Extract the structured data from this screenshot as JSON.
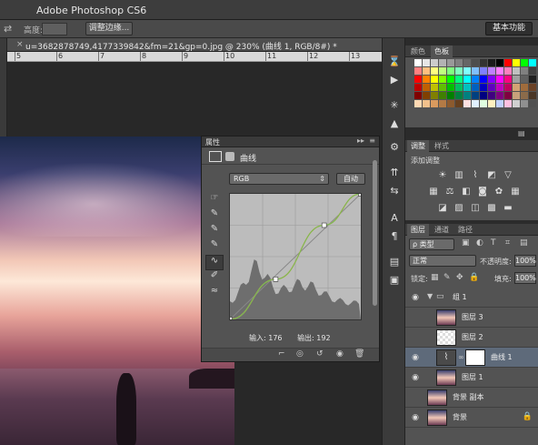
{
  "app": {
    "title": "Adobe Photoshop CS6"
  },
  "options": {
    "label": "高度:",
    "refine_edge": "调整边缘...",
    "workspace": "基本功能"
  },
  "document": {
    "tab_title": "u=3682878749,4177339842&fm=21&gp=0.jpg @ 230% (曲线 1, RGB/8#) *"
  },
  "ruler": {
    "marks": [
      "5",
      "6",
      "7",
      "8",
      "9",
      "10",
      "11",
      "12",
      "13"
    ]
  },
  "properties": {
    "title": "属性",
    "adjustment_name": "曲线",
    "preset": "RGB",
    "auto_label": "自动",
    "input_label": "输入: 176",
    "output_label": "输出: 192",
    "curve_points": [
      [
        0,
        0
      ],
      [
        0.35,
        0.32
      ],
      [
        0.72,
        0.75
      ],
      [
        1,
        1
      ]
    ]
  },
  "swatches": {
    "tabs": [
      "颜色",
      "色板"
    ],
    "active_tab": "色板",
    "colors": [
      "#ffffff",
      "#e6e6e6",
      "#cccccc",
      "#b3b3b3",
      "#999999",
      "#808080",
      "#666666",
      "#4d4d4d",
      "#333333",
      "#1a1a1a",
      "#000000",
      "#ff0000",
      "#ffff00",
      "#00ff00",
      "#00ffff",
      "#ff8080",
      "#ffbf80",
      "#ffff80",
      "#bfff80",
      "#80ff80",
      "#80ffbf",
      "#80ffff",
      "#80bfff",
      "#8080ff",
      "#bf80ff",
      "#ff80ff",
      "#ff80bf",
      "#c0c0c0",
      "#808080",
      "#404040",
      "#ff0000",
      "#ff8000",
      "#ffff00",
      "#80ff00",
      "#00ff00",
      "#00ff80",
      "#00ffff",
      "#0080ff",
      "#0000ff",
      "#8000ff",
      "#ff00ff",
      "#ff0080",
      "#a0a0a0",
      "#606060",
      "#202020",
      "#c00000",
      "#c06000",
      "#c0c000",
      "#60c000",
      "#00c000",
      "#00c060",
      "#00c0c0",
      "#0060c0",
      "#0000c0",
      "#6000c0",
      "#c000c0",
      "#c00060",
      "#d4a373",
      "#a06c3c",
      "#6b4226",
      "#800000",
      "#804000",
      "#808000",
      "#408000",
      "#008000",
      "#008040",
      "#008080",
      "#004080",
      "#000080",
      "#400080",
      "#800080",
      "#800040",
      "#c8a27a",
      "#8b6b4a",
      "#4a3625",
      "#ffd9b3",
      "#f2c18c",
      "#d99a5e",
      "#b37a45",
      "#8c5a2e",
      "#66401f",
      "#ffe0e0",
      "#e0f0ff",
      "#e0ffe0",
      "#fff0c0",
      "#c0d0ff",
      "#ffc0e0",
      "#d0d0d0",
      "#909090",
      "#505050"
    ]
  },
  "adjustments": {
    "tabs": [
      "调整",
      "样式"
    ],
    "add_label": "添加调整"
  },
  "layers": {
    "tabs": [
      "图层",
      "通道",
      "路径"
    ],
    "kind_label": "ρ 类型",
    "blend_mode": "正常",
    "opacity_label": "不透明度:",
    "opacity_value": "100%",
    "lock_label": "锁定:",
    "fill_label": "填充:",
    "fill_value": "100%",
    "items": [
      {
        "name": "组 1",
        "kind": "group"
      },
      {
        "name": "图层 3",
        "kind": "photo"
      },
      {
        "name": "图层 2",
        "kind": "checker"
      },
      {
        "name": "曲线 1",
        "kind": "curves"
      },
      {
        "name": "图层 1",
        "kind": "photo"
      },
      {
        "name": "背景 副本",
        "kind": "photo"
      },
      {
        "name": "背景",
        "kind": "photo"
      }
    ]
  }
}
